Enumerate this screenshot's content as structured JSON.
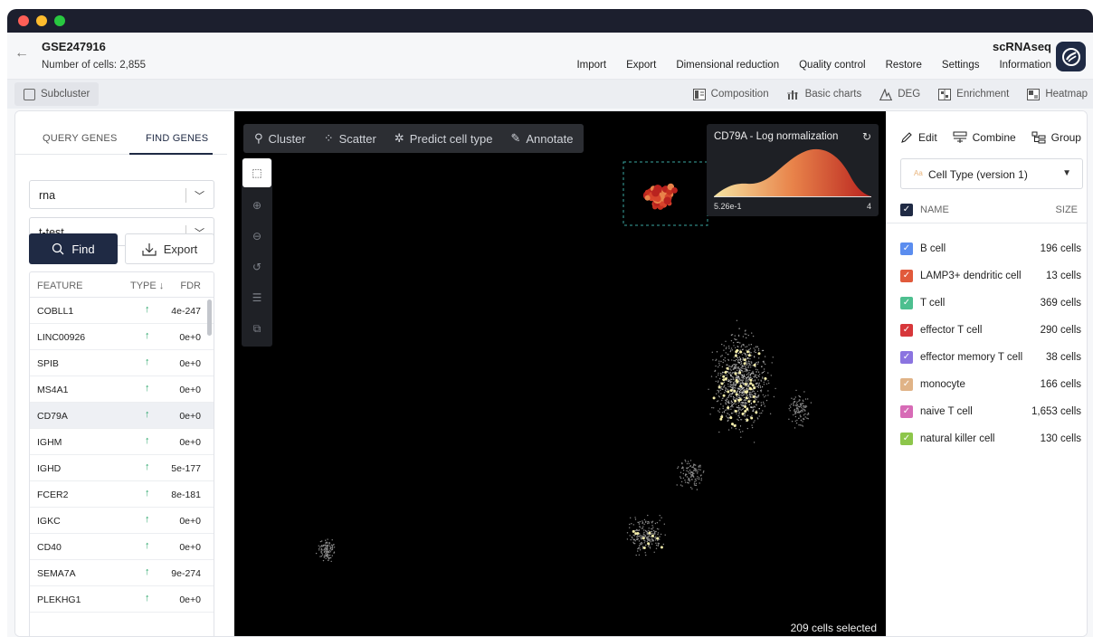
{
  "window": {
    "traffic_lights": [
      "#ff5f57",
      "#febc2e",
      "#28c840"
    ]
  },
  "header": {
    "title": "GSE247916",
    "cell_count": "Number of cells: 2,855",
    "app_type": "scRNAseq",
    "menu": [
      "Import",
      "Export",
      "Dimensional reduction",
      "Quality control",
      "Restore",
      "Settings",
      "Information"
    ]
  },
  "toolbar": {
    "subcluster_label": "Subcluster",
    "tabs": [
      "Composition",
      "Basic charts",
      "DEG",
      "Enrichment",
      "Heatmap"
    ]
  },
  "left_panel": {
    "tabs": [
      "QUERY GENES",
      "FIND GENES"
    ],
    "active_tab": "FIND GENES",
    "assay_select": "rna",
    "method_select": "t-test",
    "find_label": "Find",
    "export_label": "Export",
    "table_headers": [
      "FEATURE",
      "TYPE ↓",
      "FDR"
    ],
    "genes": [
      {
        "name": "COBLL1",
        "type": "↑",
        "fdr": "4e-247"
      },
      {
        "name": "LINC00926",
        "type": "↑",
        "fdr": "0e+0"
      },
      {
        "name": "SPIB",
        "type": "↑",
        "fdr": "0e+0"
      },
      {
        "name": "MS4A1",
        "type": "↑",
        "fdr": "0e+0"
      },
      {
        "name": "CD79A",
        "type": "↑",
        "fdr": "0e+0"
      },
      {
        "name": "IGHM",
        "type": "↑",
        "fdr": "0e+0"
      },
      {
        "name": "IGHD",
        "type": "↑",
        "fdr": "5e-177"
      },
      {
        "name": "FCER2",
        "type": "↑",
        "fdr": "8e-181"
      },
      {
        "name": "IGKC",
        "type": "↑",
        "fdr": "0e+0"
      },
      {
        "name": "CD40",
        "type": "↑",
        "fdr": "0e+0"
      },
      {
        "name": "SEMA7A",
        "type": "↑",
        "fdr": "9e-274"
      },
      {
        "name": "PLEKHG1",
        "type": "↑",
        "fdr": "0e+0"
      }
    ],
    "selected_gene_index": 4
  },
  "plot": {
    "toolbar": [
      "Cluster",
      "Scatter",
      "Predict cell type",
      "Annotate"
    ],
    "side_tools": [
      "lasso-select-icon",
      "zoom-in-icon",
      "zoom-out-icon",
      "reset-zoom-icon",
      "sliders-icon",
      "export-image-icon"
    ],
    "legend_title": "CD79A - Log normalization",
    "legend_min": "5.26e-1",
    "legend_max": "4",
    "selected_text": "209 cells selected",
    "gradient_colors": [
      "#f6e3a1",
      "#e8834a",
      "#b9231f"
    ]
  },
  "right_panel": {
    "actions": [
      "Edit",
      "Combine",
      "Group"
    ],
    "annotation_select": "Cell Type (version 1)",
    "annotation_prefix": "Aa",
    "headers": [
      "NAME",
      "SIZE"
    ],
    "cell_types": [
      {
        "name": "B cell",
        "size": "196 cells",
        "color": "#5b8def"
      },
      {
        "name": "LAMP3+ dendritic cell",
        "size": "13 cells",
        "color": "#e15a3b"
      },
      {
        "name": "T cell",
        "size": "369 cells",
        "color": "#4dbf8f"
      },
      {
        "name": "effector T cell",
        "size": "290 cells",
        "color": "#d7373a"
      },
      {
        "name": "effector memory T cell",
        "size": "38 cells",
        "color": "#8b74e0"
      },
      {
        "name": "monocyte",
        "size": "166 cells",
        "color": "#e0b387"
      },
      {
        "name": "naive T cell",
        "size": "1,653 cells",
        "color": "#d76bb6"
      },
      {
        "name": "natural killer cell",
        "size": "130 cells",
        "color": "#8dc64b"
      }
    ]
  }
}
